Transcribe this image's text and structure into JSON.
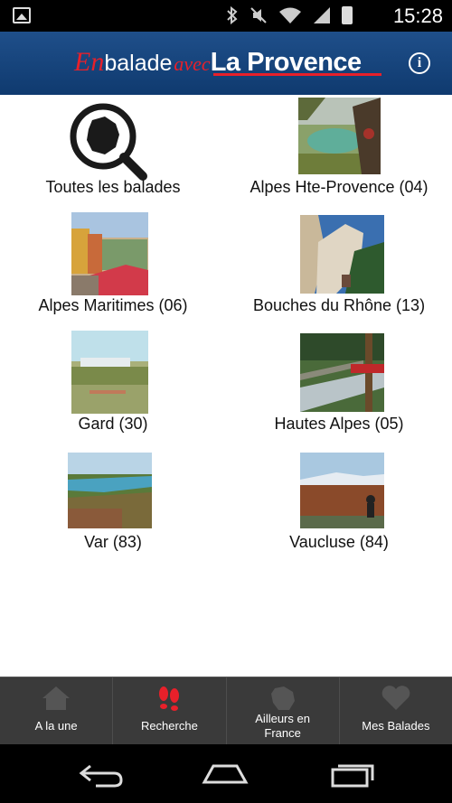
{
  "status_bar": {
    "time": "15:28",
    "icons": [
      "image-icon",
      "bluetooth-icon",
      "mute-icon",
      "wifi-icon",
      "signal-icon",
      "battery-icon"
    ]
  },
  "app_bar": {
    "logo": {
      "part1": "En",
      "part2": "balade",
      "part3": "avec",
      "part4": "La Provence"
    },
    "info_label": "i"
  },
  "regions": [
    {
      "label": "Toutes les balades",
      "icon": "search-france-icon"
    },
    {
      "label": "Alpes Hte-Provence (04)",
      "icon": "photo-lake-icon"
    },
    {
      "label": "Alpes Maritimes (06)",
      "icon": "photo-market-icon"
    },
    {
      "label": "Bouches du Rhône (13)",
      "icon": "photo-rocks-icon"
    },
    {
      "label": "Gard (30)",
      "icon": "photo-village-icon"
    },
    {
      "label": "Hautes Alpes (05)",
      "icon": "photo-bridge-icon"
    },
    {
      "label": "Var (83)",
      "icon": "photo-bay-icon"
    },
    {
      "label": "Vaucluse (84)",
      "icon": "photo-cyclist-icon"
    }
  ],
  "bottom_nav": [
    {
      "label": "A la une",
      "icon": "home-icon"
    },
    {
      "label": "Recherche",
      "icon": "footprints-icon"
    },
    {
      "label1": "Ailleurs en",
      "label2": "France",
      "icon": "france-map-icon"
    },
    {
      "label": "Mes Balades",
      "icon": "heart-icon"
    }
  ],
  "system_nav": [
    "back-icon",
    "home-icon",
    "recents-icon"
  ]
}
